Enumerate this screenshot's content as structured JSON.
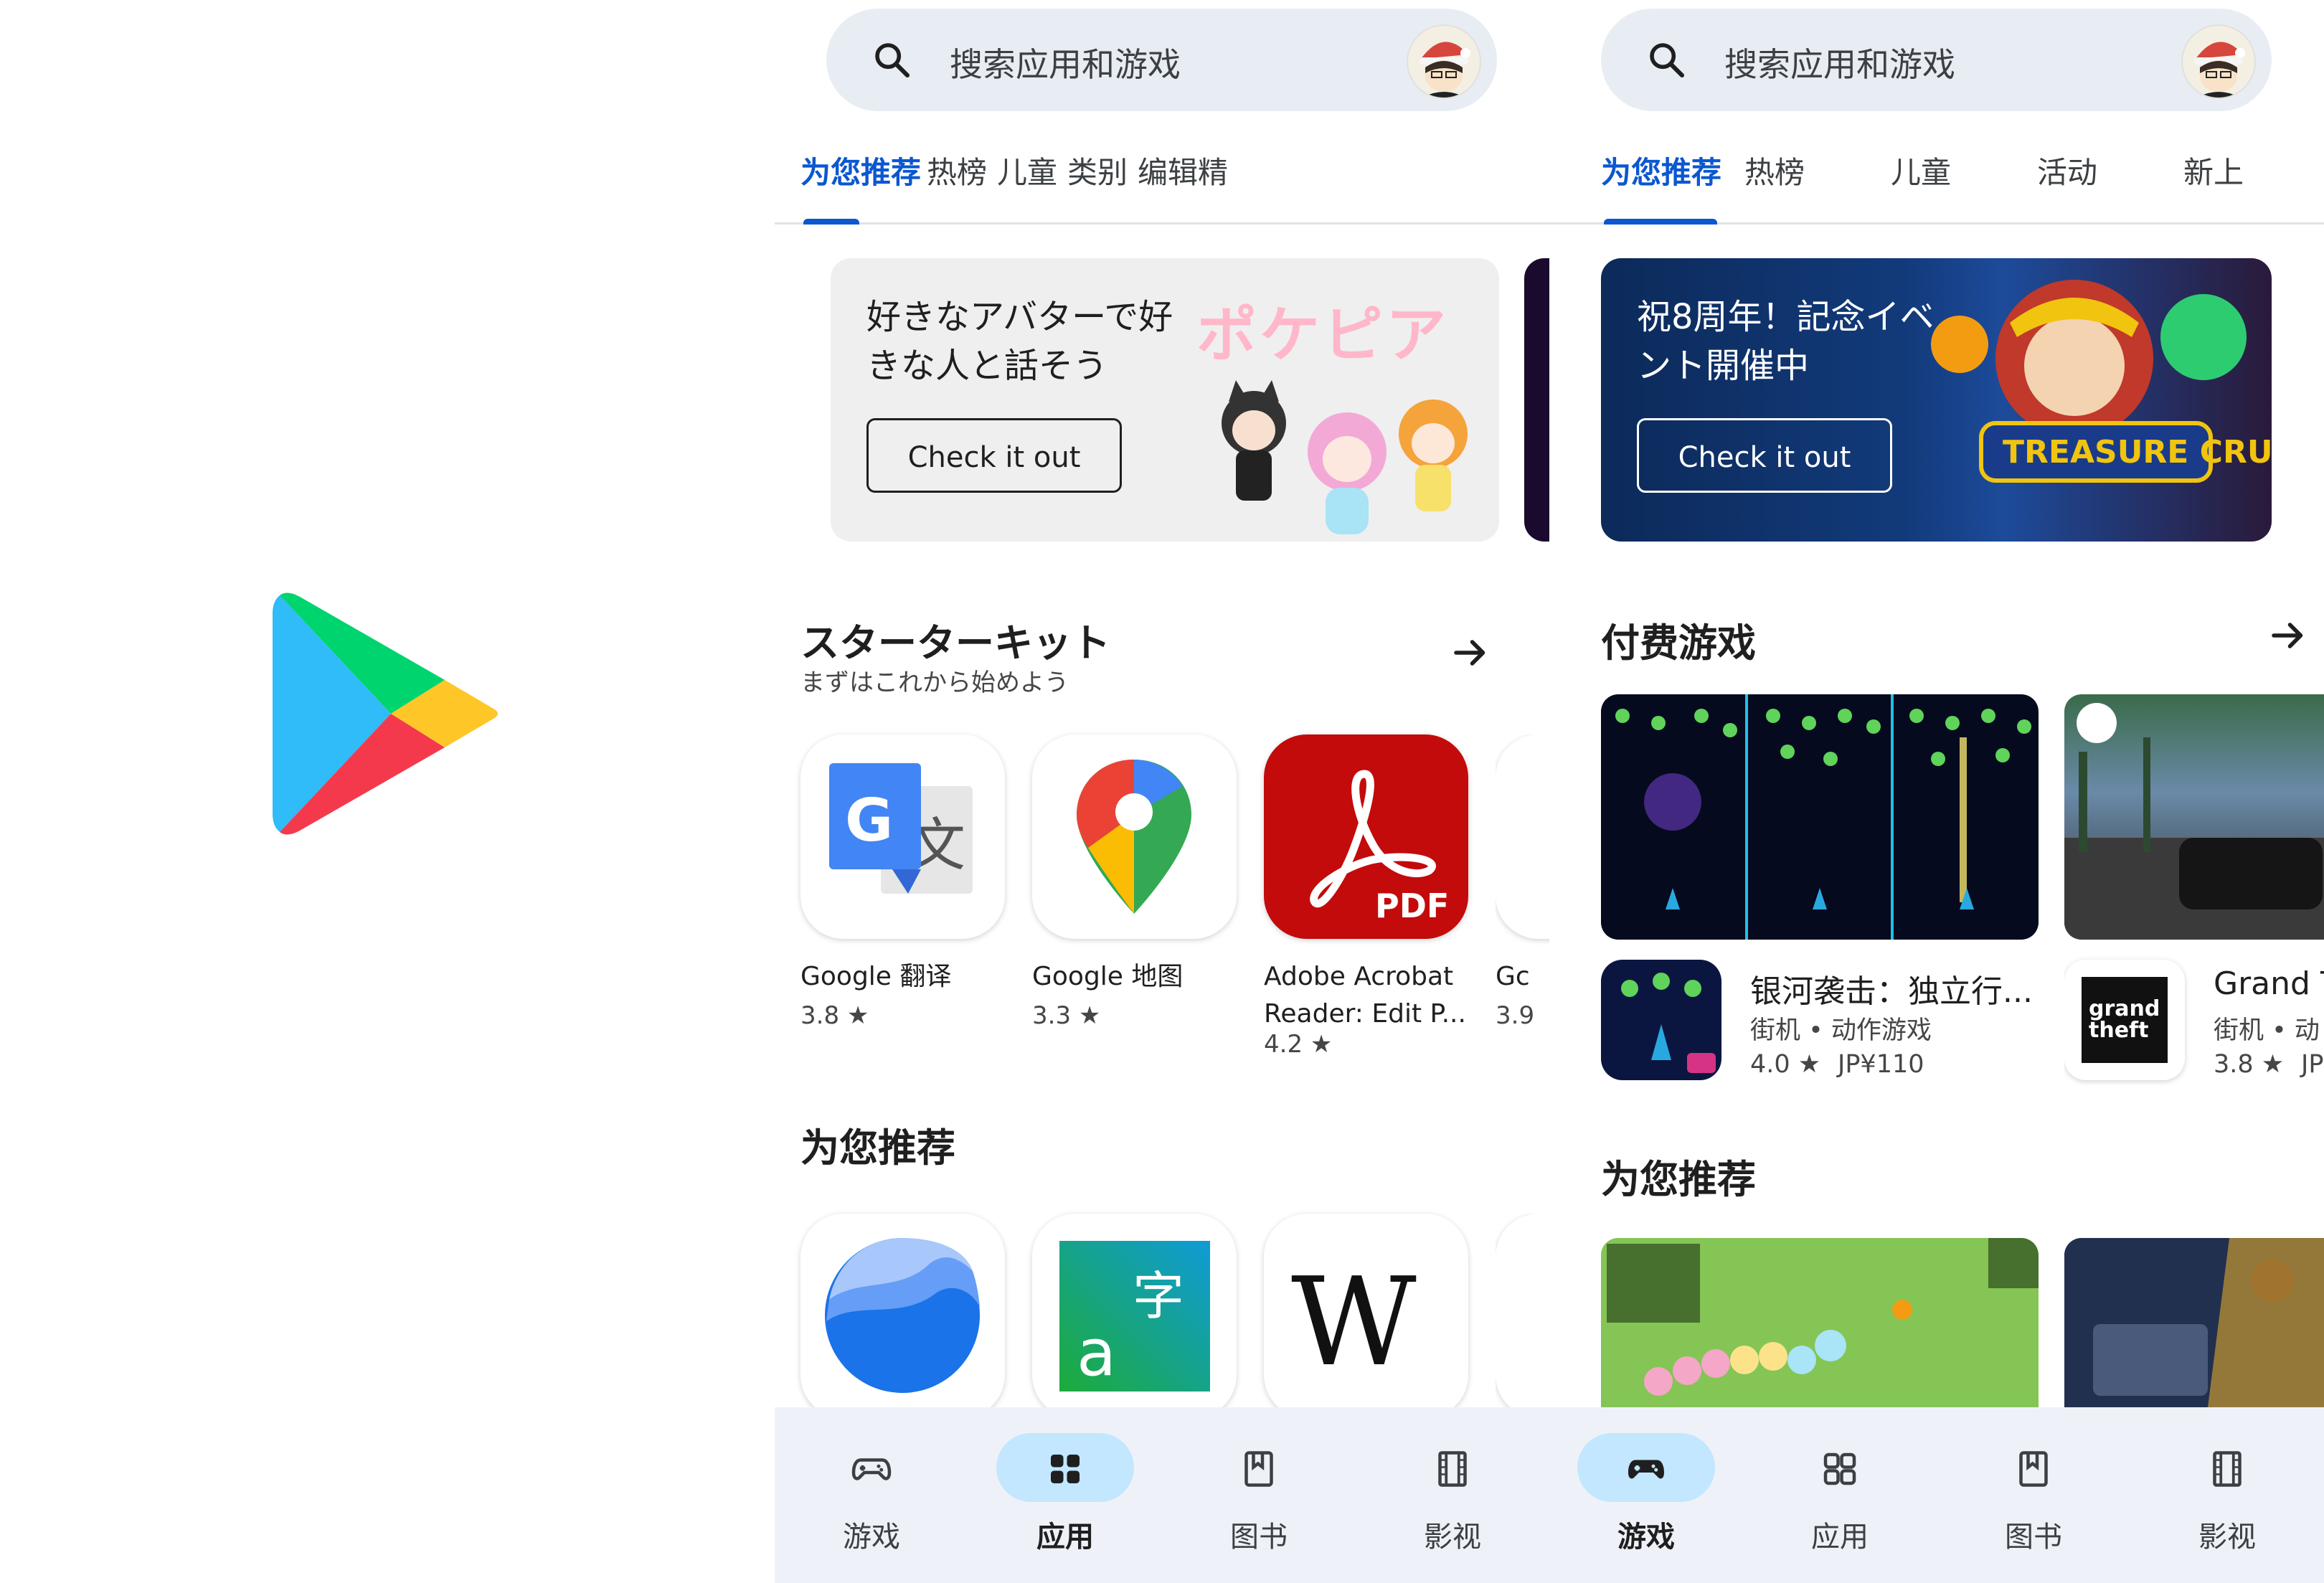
{
  "logo": {
    "name": "play-logo"
  },
  "screenA": {
    "search": {
      "placeholder": "搜索应用和游戏"
    },
    "tabs": [
      "为您推荐",
      "热榜",
      "儿童",
      "类别",
      "编辑精"
    ],
    "banner": {
      "text": "好きなアバターで好きな人と話そう",
      "button": "Check it out",
      "brand": "ポケピア"
    },
    "starter": {
      "title": "スターターキット",
      "subtitle": "まずはこれから始めよう",
      "apps": [
        {
          "name": "Google 翻译",
          "rating": "3.8 ★"
        },
        {
          "name": "Google 地图",
          "rating": "3.3 ★"
        },
        {
          "name": "Adobe Acrobat Reader: Edit P...",
          "rating": "4.2 ★",
          "pdf_label": "PDF"
        },
        {
          "name": "Gc",
          "rating": "3.9"
        }
      ]
    },
    "foryou": {
      "title": "为您推荐"
    },
    "nav": [
      {
        "label": "游戏",
        "active": false
      },
      {
        "label": "应用",
        "active": true
      },
      {
        "label": "图书",
        "active": false
      },
      {
        "label": "影视",
        "active": false
      }
    ]
  },
  "screenB": {
    "search": {
      "placeholder": "搜索应用和游戏"
    },
    "tabs": [
      "为您推荐",
      "热榜",
      "儿童",
      "活动",
      "新上"
    ],
    "banner": {
      "text": "祝8周年！記念イベント開催中",
      "button": "Check it out"
    },
    "paid": {
      "title": "付费游戏",
      "games": [
        {
          "name": "银河袭击：独立行...",
          "category": "街机 • 动作游戏",
          "rating": "4.0 ★",
          "price": "JP¥110"
        },
        {
          "name": "Grand T",
          "category": "街机 • 动",
          "rating": "3.8 ★",
          "price": "JP"
        }
      ]
    },
    "foryou": {
      "title": "为您推荐"
    },
    "nav": [
      {
        "label": "游戏",
        "active": true
      },
      {
        "label": "应用",
        "active": false
      },
      {
        "label": "图书",
        "active": false
      },
      {
        "label": "影视",
        "active": false
      }
    ]
  },
  "colors": {
    "accent": "#0b57d0",
    "nav_active": "#c2e7ff",
    "search_bg": "#e8edf4"
  }
}
